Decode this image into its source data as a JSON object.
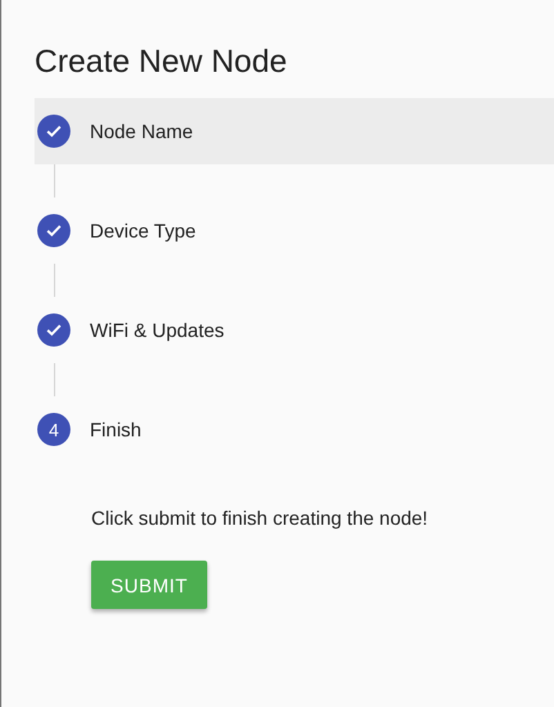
{
  "title": "Create New Node",
  "steps": [
    {
      "label": "Node Name",
      "completed": true,
      "highlighted": true
    },
    {
      "label": "Device Type",
      "completed": true,
      "highlighted": false
    },
    {
      "label": "WiFi & Updates",
      "completed": true,
      "highlighted": false
    },
    {
      "label": "Finish",
      "completed": false,
      "highlighted": false,
      "number": "4"
    }
  ],
  "message": "Click submit to finish creating the node!",
  "submit_button": "SUBMIT"
}
